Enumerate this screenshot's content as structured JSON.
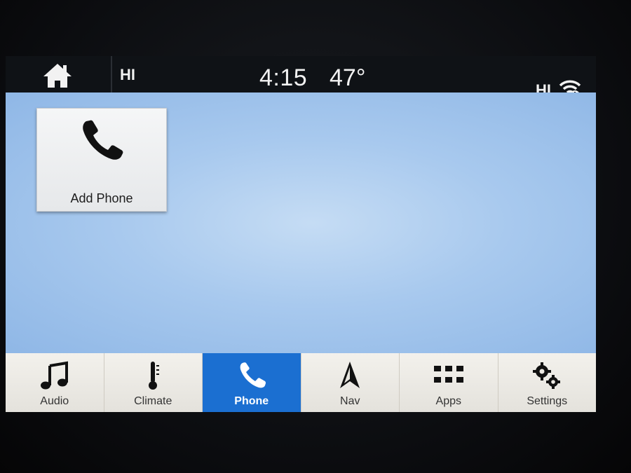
{
  "status_bar": {
    "home_icon": "home-icon",
    "left_label": "HI",
    "time": "4:15",
    "temperature": "47°",
    "right_label": "HI",
    "wifi_icon": "wifi-alert-icon"
  },
  "main": {
    "tiles": [
      {
        "label": "Add Phone",
        "icon": "phone-icon"
      }
    ]
  },
  "nav": {
    "items": [
      {
        "label": "Audio",
        "icon": "music-note-icon",
        "active": false
      },
      {
        "label": "Climate",
        "icon": "thermometer-icon",
        "active": false
      },
      {
        "label": "Phone",
        "icon": "phone-icon",
        "active": true
      },
      {
        "label": "Nav",
        "icon": "navigation-arrow-icon",
        "active": false
      },
      {
        "label": "Apps",
        "icon": "apps-grid-icon",
        "active": false
      },
      {
        "label": "Settings",
        "icon": "gears-icon",
        "active": false
      }
    ]
  },
  "colors": {
    "active_tab": "#1b6fd1",
    "screen_background": "#a8c9ee",
    "status_bar": "#0f1216"
  }
}
